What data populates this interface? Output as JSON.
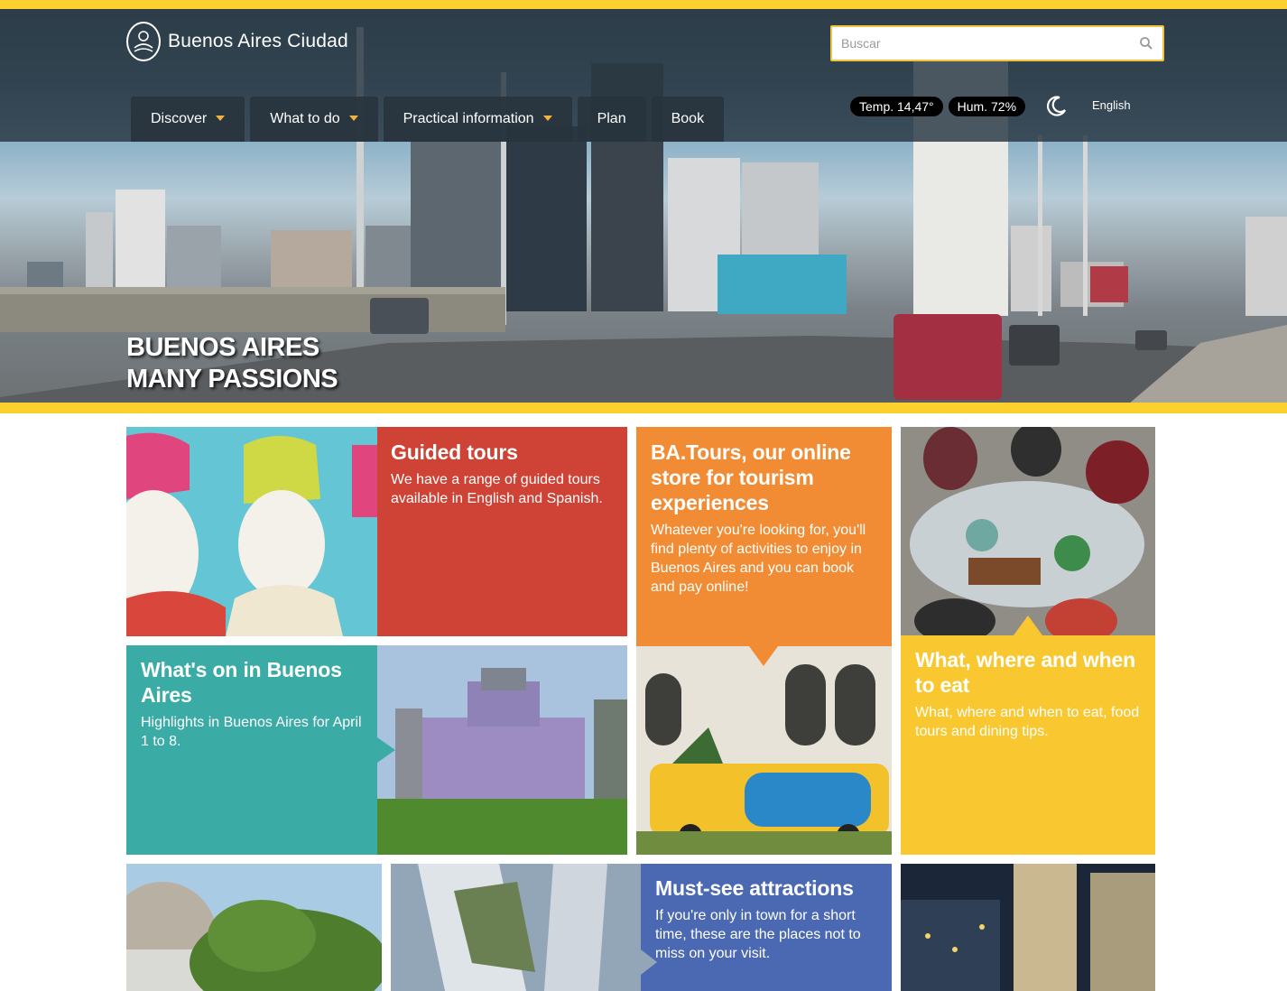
{
  "site": {
    "name": "Buenos Aires Ciudad"
  },
  "search": {
    "placeholder": "Buscar"
  },
  "nav": [
    {
      "label": "Discover",
      "dropdown": true
    },
    {
      "label": "What to do",
      "dropdown": true
    },
    {
      "label": "Practical information",
      "dropdown": true
    },
    {
      "label": "Plan",
      "dropdown": false
    },
    {
      "label": "Book",
      "dropdown": false
    }
  ],
  "weather": {
    "temp": "Temp. 14,47°",
    "humidity": "Hum. 72%"
  },
  "language": "English",
  "hero": {
    "line1": "BUENOS AIRES",
    "line2": "MANY PASSIONS"
  },
  "tiles": {
    "guided": {
      "title": "Guided tours",
      "desc": "We have a range of guided tours available in English and Spanish."
    },
    "batours": {
      "title": "BA.Tours, our online store for tourism experiences",
      "desc": "Whatever you're looking for, you'll find plenty of activities to enjoy in Buenos Aires and you can book and pay online!"
    },
    "eat": {
      "title": "What, where and when to eat",
      "desc": "What, where and when to eat, food tours and dining tips."
    },
    "whatson": {
      "title": "What's on in Buenos Aires",
      "desc": "Highlights in Buenos Aires for April 1 to 8."
    },
    "mustsee": {
      "title": "Must-see attractions",
      "desc": "If you're only in town for a short time, these are the places not to miss on your visit."
    }
  },
  "colors": {
    "accent_yellow": "#fdd12d",
    "red": "#cf4336",
    "orange": "#f28c34",
    "yellow_tile": "#f9c830",
    "teal": "#3aaca5",
    "blue": "#4b69b3"
  }
}
